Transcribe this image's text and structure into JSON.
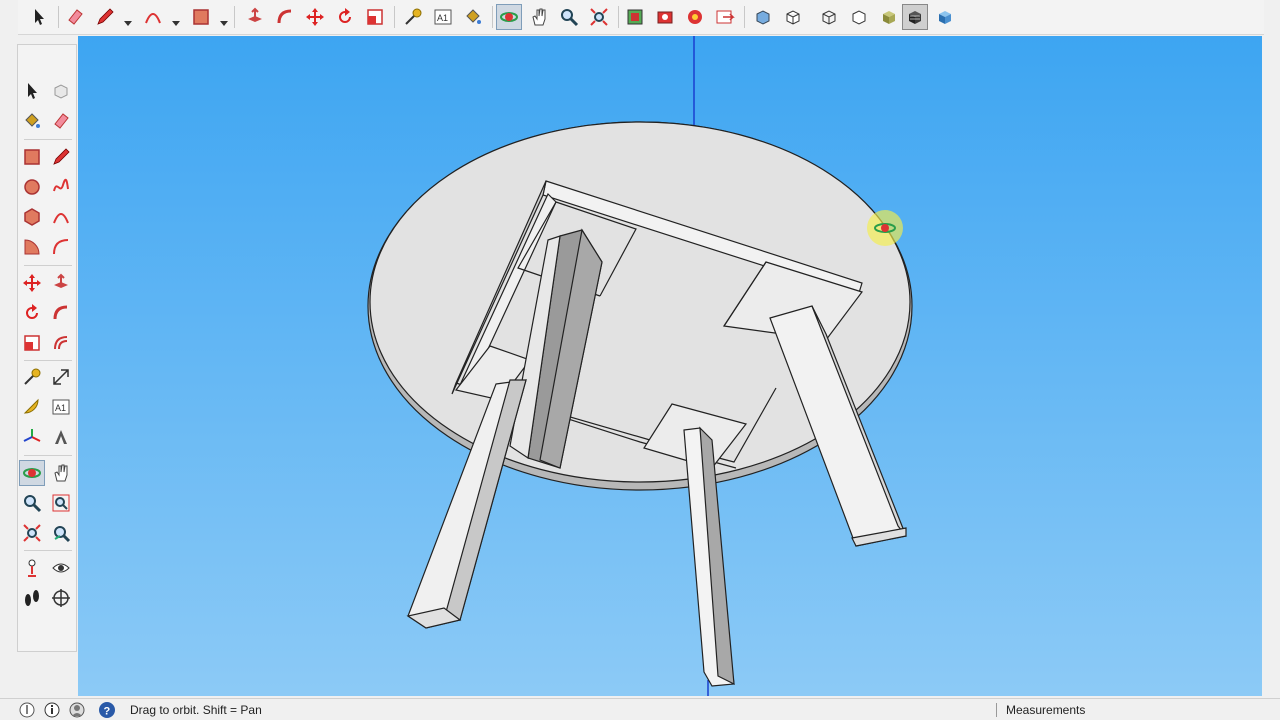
{
  "toolbar": {
    "tools": [
      {
        "name": "select-tool",
        "icon": "arrow-icon"
      },
      {
        "name": "eraser-tool",
        "icon": "eraser-icon"
      },
      {
        "name": "line-tool",
        "icon": "pencil-icon"
      },
      {
        "name": "arc-tool",
        "icon": "arc-icon"
      },
      {
        "name": "rectangle-tool",
        "icon": "rectangle-icon"
      },
      {
        "name": "push-pull-tool",
        "icon": "push-pull-icon"
      },
      {
        "name": "follow-me-tool",
        "icon": "follow-me-icon"
      },
      {
        "name": "move-tool",
        "icon": "move-icon"
      },
      {
        "name": "rotate-tool",
        "icon": "rotate-icon"
      },
      {
        "name": "scale-tool",
        "icon": "scale-icon"
      },
      {
        "name": "tape-measure-tool",
        "icon": "tape-measure-icon"
      },
      {
        "name": "text-tool",
        "icon": "text-icon"
      },
      {
        "name": "paint-bucket-tool",
        "icon": "paint-bucket-icon"
      },
      {
        "name": "orbit-tool",
        "icon": "orbit-icon",
        "active": true
      },
      {
        "name": "pan-tool",
        "icon": "hand-icon"
      },
      {
        "name": "zoom-tool",
        "icon": "magnifier-icon"
      },
      {
        "name": "zoom-extents-tool",
        "icon": "zoom-extents-icon"
      },
      {
        "name": "warehouse-tool",
        "icon": "warehouse-icon"
      },
      {
        "name": "extension-warehouse-tool",
        "icon": "extension-icon"
      },
      {
        "name": "extension-manager-tool",
        "icon": "extension-manager-icon"
      },
      {
        "name": "layout-tool",
        "icon": "layout-icon"
      },
      {
        "name": "xray-style",
        "icon": "xray-cube-icon"
      },
      {
        "name": "back-edges-style",
        "icon": "back-edges-cube-icon"
      },
      {
        "name": "wireframe-style",
        "icon": "wireframe-cube-icon"
      },
      {
        "name": "hidden-line-style",
        "icon": "hidden-line-cube-icon"
      },
      {
        "name": "shaded-style",
        "icon": "shaded-cube-icon"
      },
      {
        "name": "shaded-textures-style",
        "icon": "shaded-textures-cube-icon",
        "active": true
      },
      {
        "name": "monochrome-style",
        "icon": "monochrome-cube-icon"
      }
    ]
  },
  "left_toolbar": {
    "tools": [
      {
        "name": "select",
        "icon": "arrow-icon"
      },
      {
        "name": "make-component",
        "icon": "component-icon"
      },
      {
        "name": "paint-bucket",
        "icon": "paint-bucket-icon"
      },
      {
        "name": "eraser",
        "icon": "eraser-icon"
      },
      {
        "name": "rectangle",
        "icon": "rectangle-icon"
      },
      {
        "name": "line",
        "icon": "pencil-icon"
      },
      {
        "name": "circle",
        "icon": "circle-icon"
      },
      {
        "name": "freehand",
        "icon": "freehand-icon"
      },
      {
        "name": "polygon",
        "icon": "polygon-icon"
      },
      {
        "name": "arc",
        "icon": "arc-icon"
      },
      {
        "name": "pie",
        "icon": "pie-icon"
      },
      {
        "name": "two-point-arc",
        "icon": "two-point-arc-icon"
      },
      {
        "name": "move",
        "icon": "move-icon"
      },
      {
        "name": "push-pull",
        "icon": "push-pull-icon"
      },
      {
        "name": "rotate",
        "icon": "rotate-icon"
      },
      {
        "name": "follow-me",
        "icon": "follow-me-icon"
      },
      {
        "name": "scale",
        "icon": "scale-icon"
      },
      {
        "name": "offset",
        "icon": "offset-icon"
      },
      {
        "name": "tape-measure",
        "icon": "tape-measure-icon"
      },
      {
        "name": "dimension",
        "icon": "dimension-icon"
      },
      {
        "name": "protractor",
        "icon": "protractor-icon"
      },
      {
        "name": "text",
        "icon": "text-icon"
      },
      {
        "name": "axes",
        "icon": "axes-icon"
      },
      {
        "name": "3d-text",
        "icon": "3d-text-icon"
      },
      {
        "name": "orbit",
        "icon": "orbit-icon",
        "active": true
      },
      {
        "name": "pan",
        "icon": "hand-icon"
      },
      {
        "name": "zoom",
        "icon": "magnifier-icon"
      },
      {
        "name": "zoom-window",
        "icon": "zoom-window-icon"
      },
      {
        "name": "zoom-extents",
        "icon": "zoom-extents-icon"
      },
      {
        "name": "previous-view",
        "icon": "previous-view-icon"
      },
      {
        "name": "position-camera",
        "icon": "position-camera-icon"
      },
      {
        "name": "look-around",
        "icon": "eye-icon"
      },
      {
        "name": "walk",
        "icon": "footprints-icon"
      },
      {
        "name": "section-plane",
        "icon": "section-plane-icon"
      }
    ]
  },
  "viewport": {
    "sky_top": "#3da5f2",
    "sky_bottom": "#8ccaf6",
    "model": "round-table-with-four-legs"
  },
  "statusbar": {
    "status_text": "Drag to orbit.  Shift = Pan",
    "measurements_label": "Measurements",
    "measurements_value": ""
  }
}
